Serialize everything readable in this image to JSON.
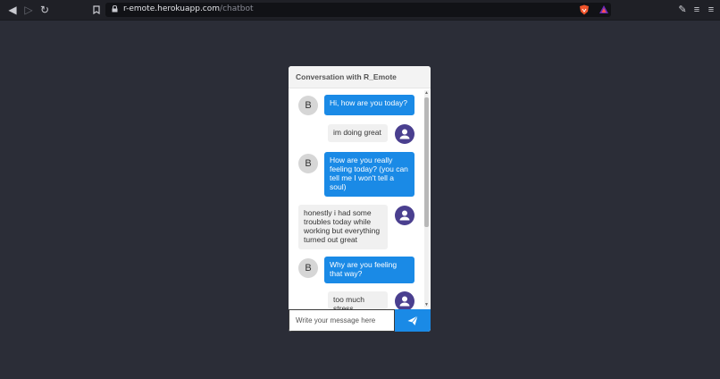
{
  "browser": {
    "url_host": "r-emote.herokuapp.com",
    "url_path": "/chatbot"
  },
  "chat": {
    "title": "Conversation with R_Emote",
    "bot_avatar_letter": "B",
    "messages": [
      {
        "from": "bot",
        "text": "Hi, how are you today?"
      },
      {
        "from": "user",
        "text": "im doing great"
      },
      {
        "from": "bot",
        "text": "How are you really feeling today? (you can tell me I won't tell a soul)"
      },
      {
        "from": "user",
        "text": "honestly i had some troubles today while working but everything turned out great"
      },
      {
        "from": "bot",
        "text": "Why are you feeling that way?"
      },
      {
        "from": "user",
        "text": "too much stress"
      }
    ],
    "input_placeholder": "Write your message here",
    "accent_color": "#1a8ae6",
    "user_avatar_color": "#4a3f8f"
  }
}
